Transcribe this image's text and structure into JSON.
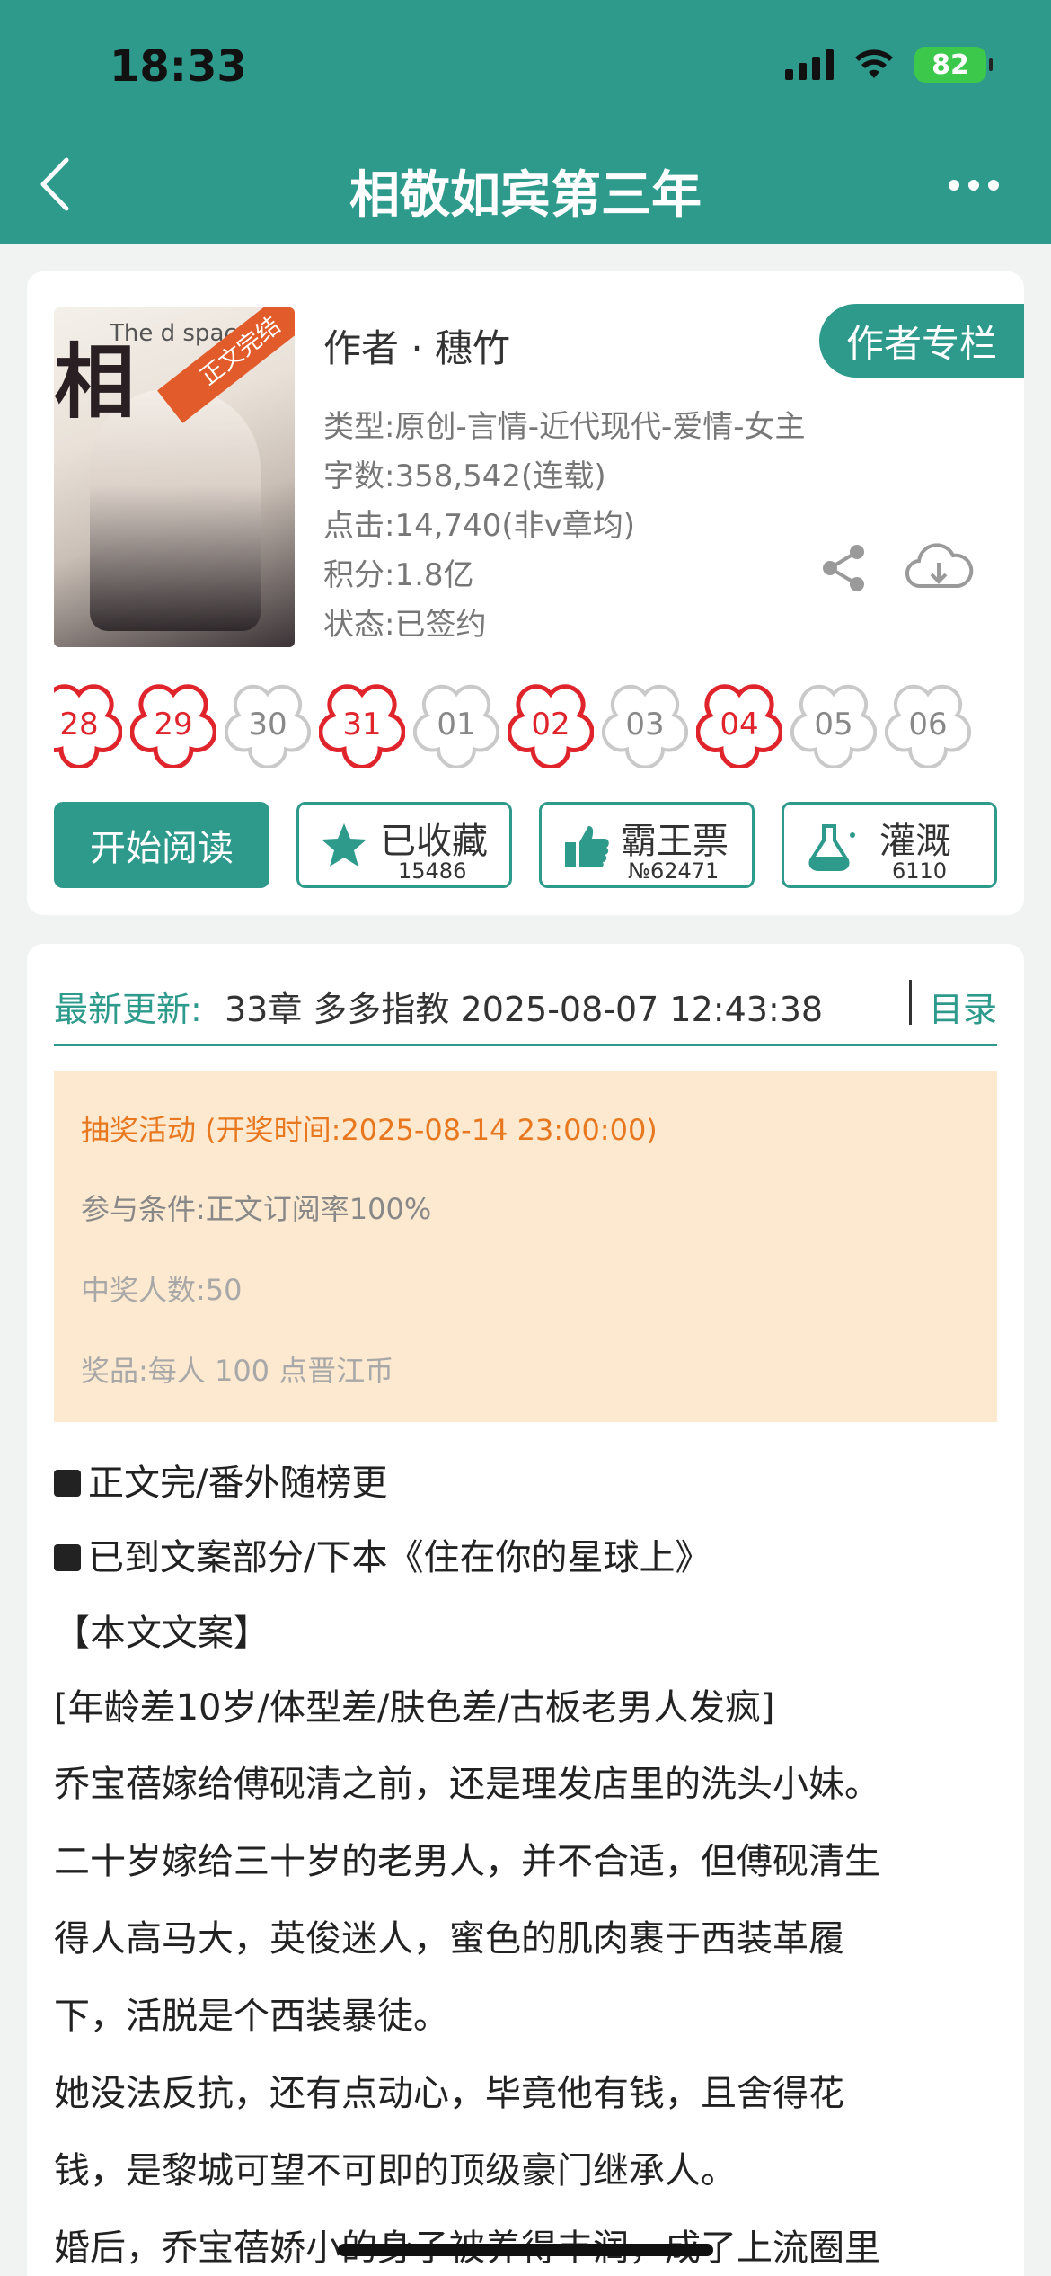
{
  "status_bar": {
    "time": "18:33",
    "battery": "82"
  },
  "header": {
    "title": "相敬如宾第三年"
  },
  "book": {
    "author": "作者 · 穗竹",
    "author_column_button": "作者专栏",
    "cover": {
      "ribbon": "正文完结",
      "title_char": "相",
      "english_text": "The d space"
    },
    "meta": [
      "类型:原创-言情-近代现代-爱情-女主",
      "字数:358,542(连载)",
      "点击:14,740(非v章均)",
      "积分:1.8亿",
      "状态:已签约"
    ]
  },
  "date_strip": [
    {
      "label": "28",
      "active": true
    },
    {
      "label": "29",
      "active": true
    },
    {
      "label": "30",
      "active": false
    },
    {
      "label": "31",
      "active": true
    },
    {
      "label": "01",
      "active": false
    },
    {
      "label": "02",
      "active": true
    },
    {
      "label": "03",
      "active": false
    },
    {
      "label": "04",
      "active": true
    },
    {
      "label": "05",
      "active": false
    },
    {
      "label": "06",
      "active": false
    }
  ],
  "actions": {
    "read": "开始阅读",
    "collect": {
      "label": "已收藏",
      "count": "15486"
    },
    "ticket": {
      "label": "霸王票",
      "count": "№62471"
    },
    "water": {
      "label": "灌溉",
      "count": "6110"
    }
  },
  "update": {
    "label": "最新更新:",
    "text": "33章 多多指教 2025-08-07 12:43:38",
    "toc": "目录"
  },
  "lottery": {
    "title": "抽奖活动 (开奖时间:2025-08-14 23:00:00)",
    "condition": "参与条件:正文订阅率100%",
    "winners": "中奖人数:50",
    "prize": "奖品:每人 100 点晋江币"
  },
  "synopsis": [
    "正文完/番外随榜更",
    "已到文案部分/下本《住在你的星球上》",
    "【本文文案】",
    "[年龄差10岁/体型差/肤色差/古板老男人发疯]",
    "乔宝蓓嫁给傅砚清之前，还是理发店里的洗头小妹。",
    "二十岁嫁给三十岁的老男人，并不合适，但傅砚清生",
    "得人高马大，英俊迷人，蜜色的肌肉裹于西装革履",
    "下，活脱是个西装暴徒。",
    "她没法反抗，还有点动心，毕竟他有钱，且舍得花",
    "钱，是黎城可望不可即的顶级豪门继承人。",
    "婚后，乔宝蓓娇小的身子被养得丰润，成了上流圈里"
  ],
  "colors": {
    "accent": "#2e9a8c",
    "flower_active": "#e0242c",
    "flower_inactive": "#c9c9c9",
    "lottery_bg": "#fde9cf",
    "lottery_title": "#e8781f"
  }
}
